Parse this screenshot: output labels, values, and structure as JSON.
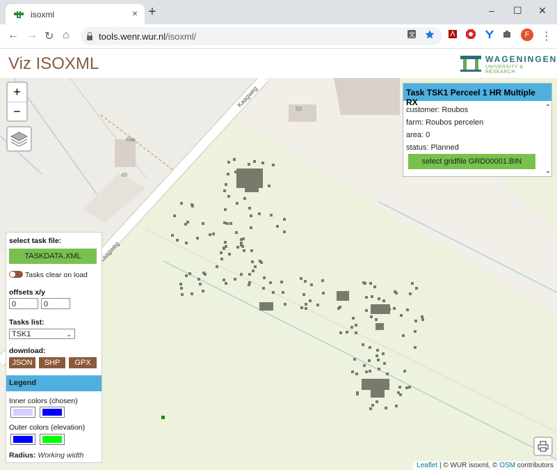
{
  "browser": {
    "tab_title": "isoxml",
    "tab_close": "×",
    "new_tab": "+",
    "url_host": "tools.wenr.wur.nl",
    "url_path": "/isoxml/",
    "profile_initial": "F",
    "window_controls": [
      "–",
      "☐",
      "✕"
    ]
  },
  "app": {
    "title": "Viz ISOXML",
    "logo_name": "WAGENINGEN",
    "logo_sub": "UNIVERSITY & RESEARCH"
  },
  "map": {
    "zoom_in": "+",
    "zoom_out": "−",
    "road_label": "Kaagweg",
    "house_numbers": [
      "50",
      "49a",
      "49"
    ],
    "attribution": {
      "leaflet": "Leaflet",
      "sep1": " | © WUR isoxml, © ",
      "osm": "OSM",
      "rest": " contributors"
    }
  },
  "task_panel": {
    "title": "Task TSK1 Perceel 1 HR Multiple RX",
    "customer": "customer: Roubos",
    "farm": "farm: Roubos percelen",
    "area": "area: 0",
    "status": "status: Planned",
    "gridfile_button": "select gridfile GRD00001.BIN"
  },
  "left_panel": {
    "select_label": "select task file:",
    "taskdata_button": "TASKDATA.XML",
    "clear_toggle_label": "Tasks clear on load",
    "offsets_label": "offsets x/y",
    "offset_x": "0",
    "offset_y": "0",
    "tasks_label": "Tasks list:",
    "task_selected": "TSK1",
    "download_label": "download:",
    "download_buttons": [
      "JSON",
      "SHP",
      "GPX"
    ],
    "legend_title": "Legend",
    "inner_label": "Inner colors (chosen)",
    "outer_label": "Outer colors (elevation)",
    "radius_label": "Radius:",
    "radius_value": "Working width"
  },
  "colors": {
    "accent_blue": "#4fb0e0",
    "green_button": "#78c14e",
    "brown": "#8b5a3c",
    "inner_1": "#d4d0ff",
    "inner_2": "#0000ff",
    "outer_1": "#0000ff",
    "outer_2": "#00ff00",
    "grid_cell": "#787a6c"
  },
  "icons": [
    "back-icon",
    "forward-icon",
    "reload-icon",
    "home-icon",
    "lock-icon",
    "translate-icon",
    "star-icon",
    "layers-icon",
    "print-icon"
  ]
}
